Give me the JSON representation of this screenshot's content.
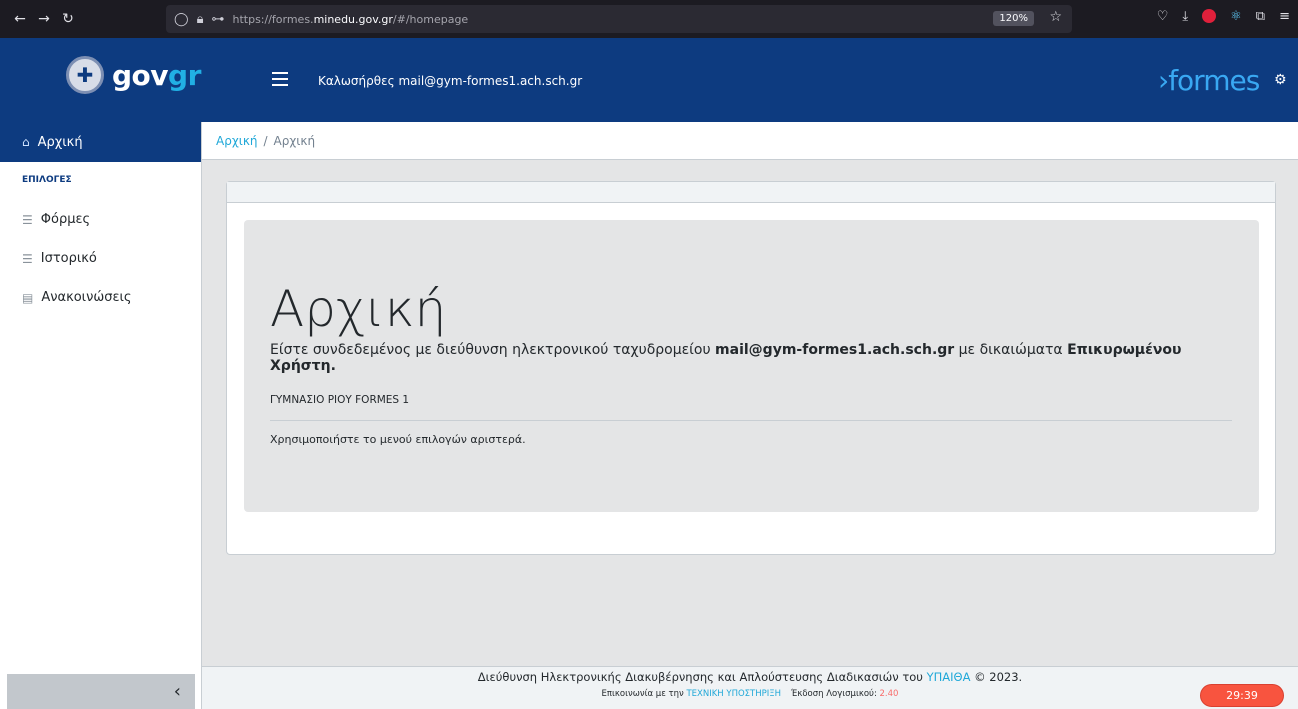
{
  "browser": {
    "url_prefix": "https://formes.",
    "url_domain": "minedu.gov.gr",
    "url_suffix": "/#/homepage",
    "zoom": "120%"
  },
  "header": {
    "logo_main": "gov",
    "logo_accent": "gr",
    "welcome": "Καλωσήρθες mail@gym-formes1.ach.sch.gr",
    "brand": "›formes"
  },
  "sidebar": {
    "active_item": "Αρχική",
    "section_title": "ΕΠΙΛΟΓΕΣ",
    "items": [
      {
        "label": "Φόρμες"
      },
      {
        "label": "Ιστορικό"
      },
      {
        "label": "Ανακοινώσεις"
      }
    ],
    "toggle": "‹"
  },
  "breadcrumb": {
    "home": "Αρχική",
    "separator": "/",
    "current": "Αρχική"
  },
  "main": {
    "title": "Αρχική",
    "lead_prefix": "Είστε συνδεδεμένος με διεύθυνση ηλεκτρονικού ταχυδρομείου ",
    "lead_email": "mail@gym-formes1.ach.sch.gr",
    "lead_middle": " με δικαιώματα ",
    "lead_role": "Επικυρωμένου Χρήστη.",
    "school": "ΓΥΜΝΑΣΙΟ ΡΙΟΥ FORMES 1",
    "instructions": "Χρησιμοποιήστε το μενού επιλογών αριστερά."
  },
  "footer": {
    "line1_prefix": "Διεύθυνση Ηλεκτρονικής Διακυβέρνησης και Απλούστευσης Διαδικασιών του ",
    "line1_link": "ΥΠΑΙΘΑ",
    "line1_suffix": " © 2023.",
    "contact_prefix": "Επικοινωνία με την ",
    "contact_link": "ΤΕΧΝΙΚΗ ΥΠΟΣΤΗΡΙΞΗ",
    "version_label": "Έκδοση Λογισμικού: ",
    "version": "2.40"
  },
  "timer": "29:39"
}
